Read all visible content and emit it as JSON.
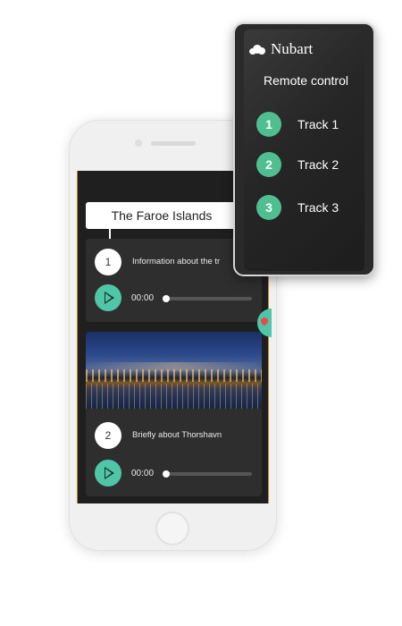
{
  "phone": {
    "title": "The Faroe Islands",
    "tracks": [
      {
        "number": "1",
        "text": "Information about the tr",
        "time": "00:00",
        "progress": 0
      },
      {
        "number": "2",
        "text": "Briefly about Thorshavn",
        "time": "00:00",
        "progress": 0
      }
    ],
    "photo_icon": "city-photo",
    "map_icon": "map-pin-icon"
  },
  "remote": {
    "brand": "Nubart",
    "subtitle": "Remote control",
    "tracks": [
      {
        "number": "1",
        "label": "Track 1"
      },
      {
        "number": "2",
        "label": "Track 2"
      },
      {
        "number": "3",
        "label": "Track 3"
      }
    ]
  },
  "colors": {
    "accent": "#4fc6a8",
    "remote_accent": "#4fbf91",
    "screen_bg": "#1f1f1f",
    "card_bg": "#2e2e2e"
  }
}
